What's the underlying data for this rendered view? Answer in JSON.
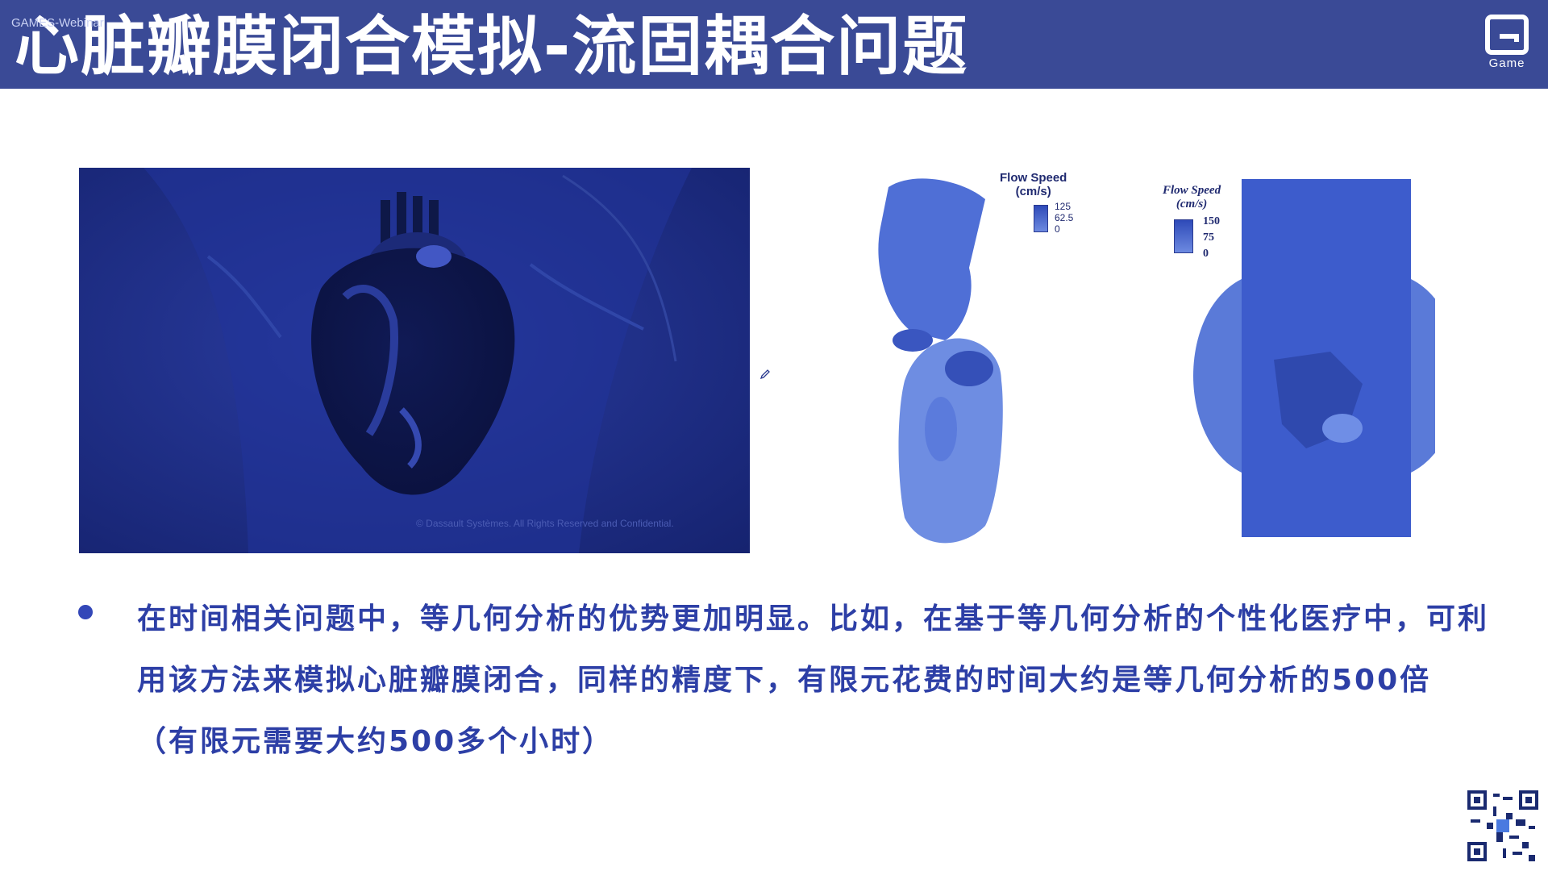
{
  "header": {
    "watermark": "GAMES-Webinar",
    "title": "心脏瓣膜闭合模拟-流固耦合问题",
    "logo_text": "Game"
  },
  "video": {
    "copyright": "© Dassault Systèmes. All Rights Reserved and Confidential."
  },
  "legend_left": {
    "title_line1": "Flow Speed",
    "title_line2": "(cm/s)",
    "values": [
      "125",
      "62.5",
      "0"
    ]
  },
  "legend_right": {
    "title_line1": "Flow Speed",
    "title_line2": "(cm/s)",
    "values": [
      "150",
      "75",
      "0"
    ]
  },
  "bullet": {
    "text": "在时间相关问题中，等几何分析的优势更加明显。比如，在基于等几何分析的个性化医疗中，可利用该方法来模拟心脏瓣膜闭合，同样的精度下，有限元花费的时间大约是等几何分析的500倍（有限元需要大约500多个小时）"
  },
  "colors": {
    "header_bg": "#3a4a96",
    "text_blue": "#2d3fa6",
    "video_bg": "#1a2a80"
  }
}
